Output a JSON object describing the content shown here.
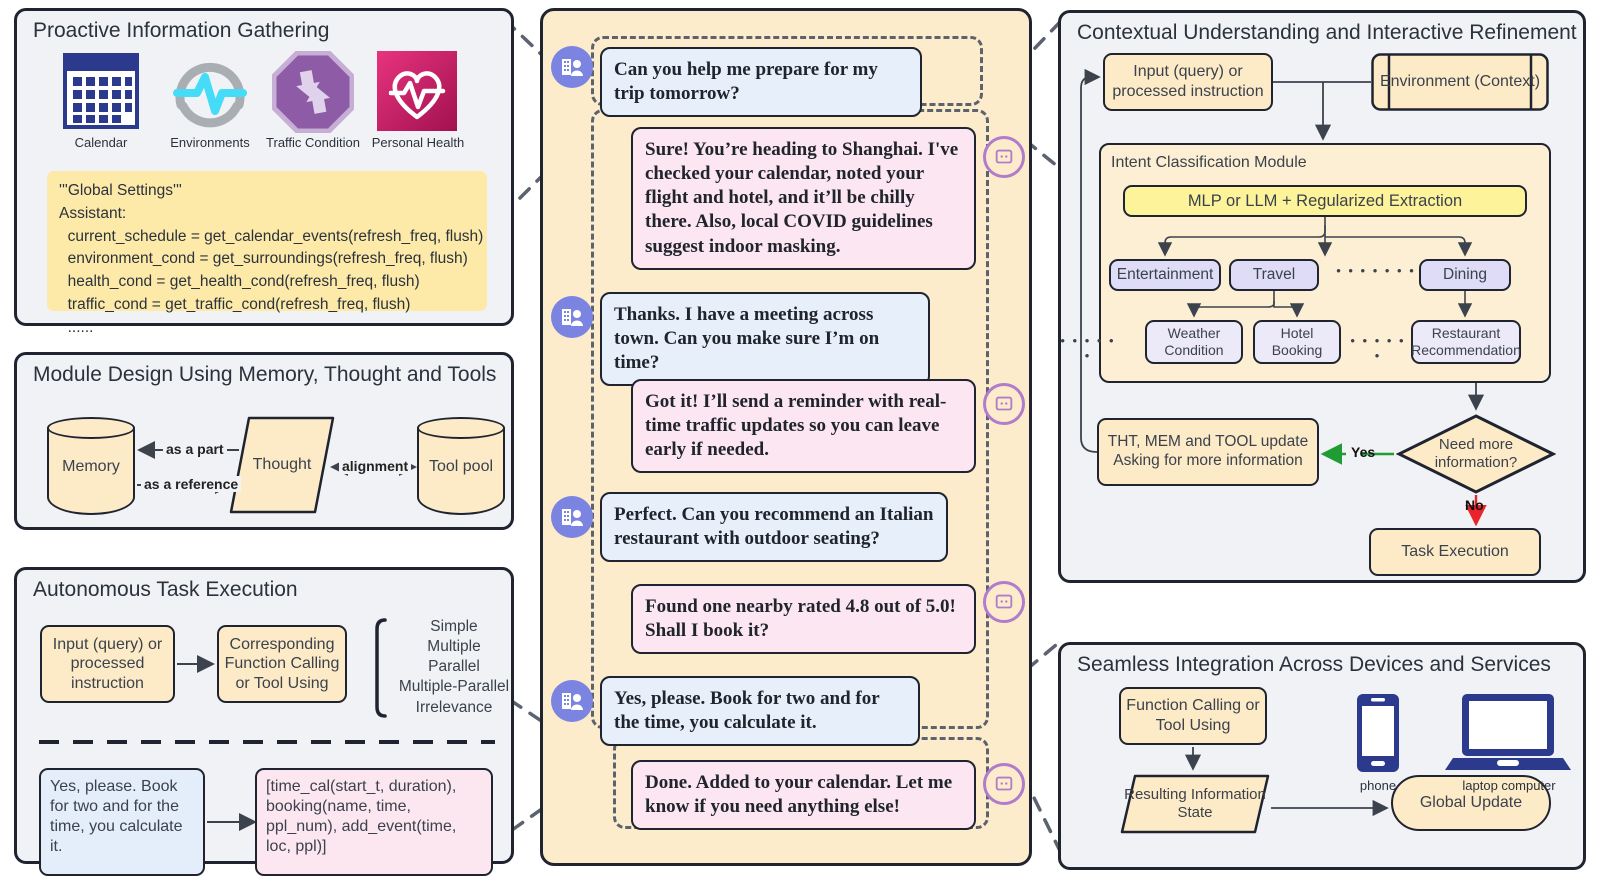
{
  "panels": {
    "proactive": {
      "title": "Proactive Information Gathering",
      "icons": [
        {
          "name": "calendar-icon",
          "label": "Calendar"
        },
        {
          "name": "environments-pulse-icon",
          "label": "Environments"
        },
        {
          "name": "traffic-condition-icon",
          "label": "Traffic Condition"
        },
        {
          "name": "personal-health-icon",
          "label": "Personal Health"
        }
      ],
      "settings_text": "'''Global Settings'''\nAssistant:\n  current_schedule = get_calendar_events(refresh_freq, flush)\n  environment_cond = get_surroundings(refresh_freq, flush)\n  health_cond = get_health_cond(refresh_freq, flush)\n  traffic_cond = get_traffic_cond(refresh_freq, flush)\n  ......"
    },
    "module_design": {
      "title": "Module Design Using Memory, Thought and Tools",
      "memory": "Memory",
      "thought": "Thought",
      "tool_pool": "Tool pool",
      "edge_as_a_part": "as a part",
      "edge_as_a_reference": "as a reference",
      "edge_alignment": "alignment"
    },
    "autonomous": {
      "title": "Autonomous Task Execution",
      "input_node": "Input (query) or processed instruction",
      "function_node": "Corresponding Function Calling or Tool Using",
      "call_types": [
        "Simple",
        "Multiple",
        "Parallel",
        "Multiple-Parallel",
        "Irrelevance"
      ],
      "user_example": "Yes, please. Book for two and for the time, you calculate it.",
      "tool_example": "[time_cal(start_t, duration), booking(name, time, ppl_num), add_event(time, loc, ppl)]"
    },
    "contextual": {
      "title": "Contextual Understanding and Interactive Refinement",
      "input_node": "Input (query) or processed instruction",
      "environment_node": "Environment (Context)",
      "intent_module_title": "Intent Classification Module",
      "mlp_node": "MLP or LLM + Regularized Extraction",
      "intents": [
        "Entertainment",
        "Travel",
        "Dining"
      ],
      "intent_dots": "• • • • • • •",
      "leaves": [
        "Weather Condition",
        "Hotel Booking",
        "Restaurant Recommendation"
      ],
      "leaf_dots_left": "• • • • • •",
      "leaf_dots_right": "• • • • • •",
      "update_node": "THT, MEM and TOOL update Asking for more information",
      "decision_node": "Need more information?",
      "yes_label": "Yes",
      "no_label": "No",
      "task_execution": "Task Execution"
    },
    "seamless": {
      "title": "Seamless Integration Across Devices and Services",
      "function_node": "Function Calling or Tool Using",
      "state_node": "Resulting Information State",
      "global_update": "Global Update",
      "devices": [
        {
          "name": "phone-icon",
          "label": "phone"
        },
        {
          "name": "laptop-computer-icon",
          "label": "laptop computer"
        }
      ]
    }
  },
  "chat": {
    "messages": [
      {
        "role": "user",
        "text": "Can you help me prepare for my trip tomorrow?"
      },
      {
        "role": "bot",
        "text": "Sure! You’re heading to Shanghai. I've checked your calendar, noted your flight and hotel, and it’ll be chilly there. Also, local COVID guidelines suggest indoor masking."
      },
      {
        "role": "user",
        "text": "Thanks. I have a meeting across town. Can you make sure I’m on time?"
      },
      {
        "role": "bot",
        "text": "Got it! I’ll send a reminder with real-time traffic updates so you can leave early if needed."
      },
      {
        "role": "user",
        "text": "Perfect. Can you recommend an Italian restaurant with outdoor seating?"
      },
      {
        "role": "bot",
        "text": "Found one nearby rated 4.8 out of 5.0! Shall I book it?"
      },
      {
        "role": "user",
        "text": "Yes, please. Book for two and for the time, you calculate it."
      },
      {
        "role": "bot",
        "text": "Done. Added to your calendar. Let me know if you need anything else!"
      }
    ]
  },
  "colors": {
    "panel_bg": "#f0f2f5",
    "chat_bg": "#fdeccb",
    "node_cream": "#fdebc8",
    "node_lavender": "#dedcf7",
    "node_yellow": "#fdf39a",
    "bubble_user": "#e6effa",
    "bubble_bot": "#fbe6f1",
    "stroke": "#1f2430",
    "avatar_user": "#7b84e0",
    "avatar_bot_ring": "#b07ccb",
    "yes_green": "#1f9d34",
    "no_red": "#e8242a",
    "calendar_blue": "#2b3a8c",
    "health_pink": "#c2185b"
  }
}
